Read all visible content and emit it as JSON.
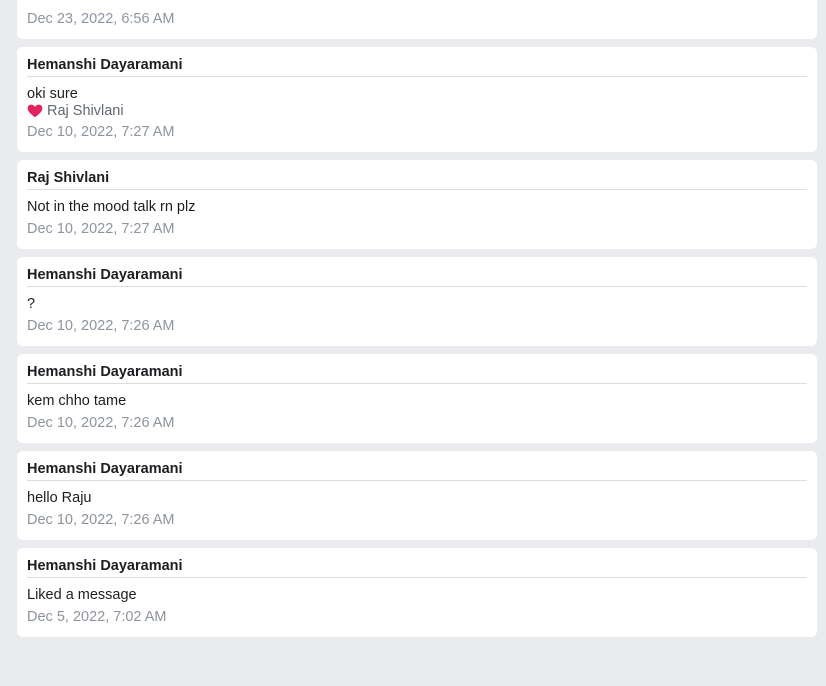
{
  "colors": {
    "page_background": "#e9ebee",
    "card_background": "#ffffff",
    "timestamp": "#8d949e",
    "heart": "#e0245e"
  },
  "messages": [
    {
      "timestamp": "Dec 23, 2022, 6:56 AM"
    },
    {
      "sender": "Hemanshi Dayaramani",
      "content": "oki sure",
      "reaction": {
        "icon": "heart-icon",
        "user": "Raj Shivlani"
      },
      "timestamp": "Dec 10, 2022, 7:27 AM"
    },
    {
      "sender": "Raj Shivlani",
      "content": "Not in the mood talk rn plz",
      "timestamp": "Dec 10, 2022, 7:27 AM"
    },
    {
      "sender": "Hemanshi Dayaramani",
      "content": "?",
      "timestamp": "Dec 10, 2022, 7:26 AM"
    },
    {
      "sender": "Hemanshi Dayaramani",
      "content": "kem chho tame",
      "timestamp": "Dec 10, 2022, 7:26 AM"
    },
    {
      "sender": "Hemanshi Dayaramani",
      "content": "hello Raju",
      "timestamp": "Dec 10, 2022, 7:26 AM"
    },
    {
      "sender": "Hemanshi Dayaramani",
      "content": "Liked a message",
      "timestamp": "Dec 5, 2022, 7:02 AM"
    }
  ]
}
